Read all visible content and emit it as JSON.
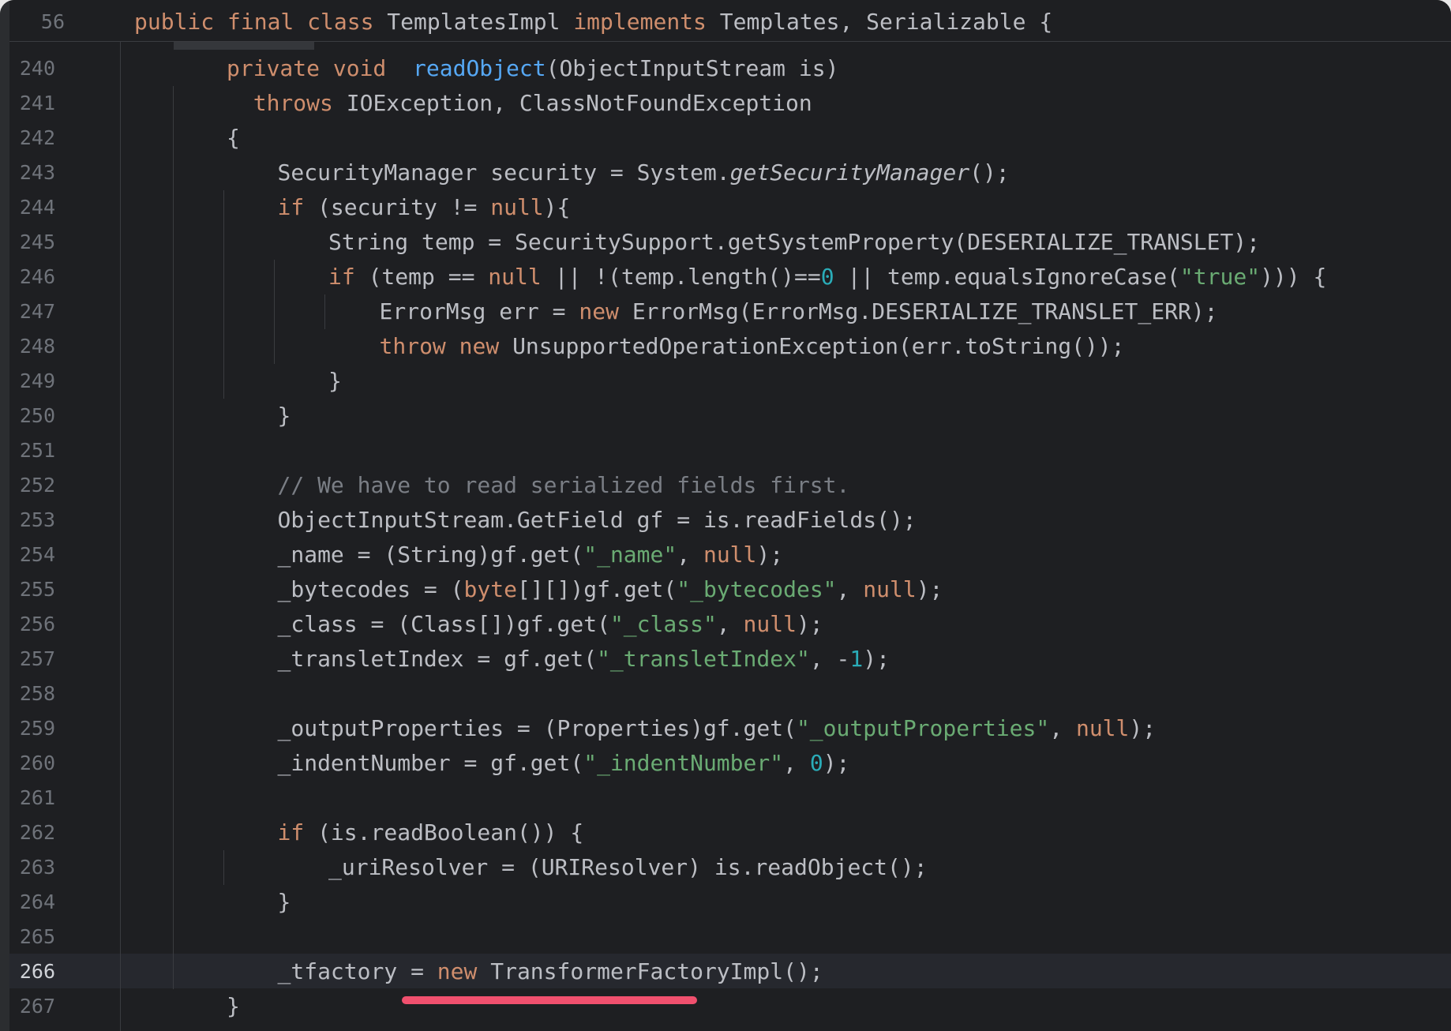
{
  "sticky_header": {
    "line_number": "56",
    "tokens": [
      {
        "t": "public final class ",
        "c": "kw"
      },
      {
        "t": "TemplatesImpl ",
        "c": ""
      },
      {
        "t": "implements ",
        "c": "kw"
      },
      {
        "t": "Templates, Serializable {",
        "c": ""
      }
    ]
  },
  "current_line": "266",
  "colors": {
    "background": "#1e1f22",
    "keyword": "#cf8e6d",
    "method_declaration": "#56a8f5",
    "string": "#6aab73",
    "number": "#2aacb8",
    "comment": "#7a7e85",
    "text": "#bcbec4",
    "underline": "#f0506e"
  },
  "lines": [
    {
      "n": "240",
      "indent": 2,
      "tokens": [
        {
          "t": "private void  ",
          "c": "kw"
        },
        {
          "t": "readObject",
          "c": "fn"
        },
        {
          "t": "(ObjectInputStream is)",
          "c": ""
        }
      ]
    },
    {
      "n": "241",
      "indent": 2,
      "tokens": [
        {
          "t": "  ",
          "c": ""
        },
        {
          "t": "throws ",
          "c": "kw"
        },
        {
          "t": "IOException, ClassNotFoundException",
          "c": ""
        }
      ]
    },
    {
      "n": "242",
      "indent": 2,
      "tokens": [
        {
          "t": "{",
          "c": ""
        }
      ]
    },
    {
      "n": "243",
      "indent": 3,
      "tokens": [
        {
          "t": "SecurityManager security = System.",
          "c": ""
        },
        {
          "t": "getSecurityManager",
          "c": "it"
        },
        {
          "t": "();",
          "c": ""
        }
      ]
    },
    {
      "n": "244",
      "indent": 3,
      "tokens": [
        {
          "t": "if ",
          "c": "kw"
        },
        {
          "t": "(security != ",
          "c": ""
        },
        {
          "t": "null",
          "c": "kw"
        },
        {
          "t": "){",
          "c": ""
        }
      ]
    },
    {
      "n": "245",
      "indent": 4,
      "tokens": [
        {
          "t": "String temp = SecuritySupport.getSystemProperty(DESERIALIZE_TRANSLET);",
          "c": ""
        }
      ]
    },
    {
      "n": "246",
      "indent": 4,
      "tokens": [
        {
          "t": "if ",
          "c": "kw"
        },
        {
          "t": "(temp == ",
          "c": ""
        },
        {
          "t": "null",
          "c": "kw"
        },
        {
          "t": " || !(temp.length()==",
          "c": ""
        },
        {
          "t": "0",
          "c": "num"
        },
        {
          "t": " || temp.equalsIgnoreCase(",
          "c": ""
        },
        {
          "t": "\"true\"",
          "c": "str"
        },
        {
          "t": "))) {",
          "c": ""
        }
      ]
    },
    {
      "n": "247",
      "indent": 5,
      "tokens": [
        {
          "t": "ErrorMsg err = ",
          "c": ""
        },
        {
          "t": "new ",
          "c": "kw"
        },
        {
          "t": "ErrorMsg(ErrorMsg.DESERIALIZE_TRANSLET_ERR);",
          "c": ""
        }
      ]
    },
    {
      "n": "248",
      "indent": 5,
      "tokens": [
        {
          "t": "throw new ",
          "c": "kw"
        },
        {
          "t": "UnsupportedOperationException(err.toString());",
          "c": ""
        }
      ]
    },
    {
      "n": "249",
      "indent": 4,
      "tokens": [
        {
          "t": "}",
          "c": ""
        }
      ]
    },
    {
      "n": "250",
      "indent": 3,
      "tokens": [
        {
          "t": "}",
          "c": ""
        }
      ]
    },
    {
      "n": "251",
      "indent": 3,
      "tokens": []
    },
    {
      "n": "252",
      "indent": 3,
      "tokens": [
        {
          "t": "// We have to read serialized fields first.",
          "c": "cm"
        }
      ]
    },
    {
      "n": "253",
      "indent": 3,
      "tokens": [
        {
          "t": "ObjectInputStream.GetField gf = is.readFields();",
          "c": ""
        }
      ]
    },
    {
      "n": "254",
      "indent": 3,
      "tokens": [
        {
          "t": "_name = (String)gf.get(",
          "c": ""
        },
        {
          "t": "\"_name\"",
          "c": "str"
        },
        {
          "t": ", ",
          "c": ""
        },
        {
          "t": "null",
          "c": "kw"
        },
        {
          "t": ");",
          "c": ""
        }
      ]
    },
    {
      "n": "255",
      "indent": 3,
      "tokens": [
        {
          "t": "_bytecodes = (",
          "c": ""
        },
        {
          "t": "byte",
          "c": "kw"
        },
        {
          "t": "[][])gf.get(",
          "c": ""
        },
        {
          "t": "\"_bytecodes\"",
          "c": "str"
        },
        {
          "t": ", ",
          "c": ""
        },
        {
          "t": "null",
          "c": "kw"
        },
        {
          "t": ");",
          "c": ""
        }
      ]
    },
    {
      "n": "256",
      "indent": 3,
      "tokens": [
        {
          "t": "_class = (Class[])gf.get(",
          "c": ""
        },
        {
          "t": "\"_class\"",
          "c": "str"
        },
        {
          "t": ", ",
          "c": ""
        },
        {
          "t": "null",
          "c": "kw"
        },
        {
          "t": ");",
          "c": ""
        }
      ]
    },
    {
      "n": "257",
      "indent": 3,
      "tokens": [
        {
          "t": "_transletIndex = gf.get(",
          "c": ""
        },
        {
          "t": "\"_transletIndex\"",
          "c": "str"
        },
        {
          "t": ", -",
          "c": ""
        },
        {
          "t": "1",
          "c": "num"
        },
        {
          "t": ");",
          "c": ""
        }
      ]
    },
    {
      "n": "258",
      "indent": 3,
      "tokens": []
    },
    {
      "n": "259",
      "indent": 3,
      "tokens": [
        {
          "t": "_outputProperties = (Properties)gf.get(",
          "c": ""
        },
        {
          "t": "\"_outputProperties\"",
          "c": "str"
        },
        {
          "t": ", ",
          "c": ""
        },
        {
          "t": "null",
          "c": "kw"
        },
        {
          "t": ");",
          "c": ""
        }
      ]
    },
    {
      "n": "260",
      "indent": 3,
      "tokens": [
        {
          "t": "_indentNumber = gf.get(",
          "c": ""
        },
        {
          "t": "\"_indentNumber\"",
          "c": "str"
        },
        {
          "t": ", ",
          "c": ""
        },
        {
          "t": "0",
          "c": "num"
        },
        {
          "t": ");",
          "c": ""
        }
      ]
    },
    {
      "n": "261",
      "indent": 3,
      "tokens": []
    },
    {
      "n": "262",
      "indent": 3,
      "tokens": [
        {
          "t": "if ",
          "c": "kw"
        },
        {
          "t": "(is.readBoolean()) {",
          "c": ""
        }
      ]
    },
    {
      "n": "263",
      "indent": 4,
      "tokens": [
        {
          "t": "_uriResolver = (URIResolver) is.readObject();",
          "c": ""
        }
      ]
    },
    {
      "n": "264",
      "indent": 3,
      "tokens": [
        {
          "t": "}",
          "c": ""
        }
      ]
    },
    {
      "n": "265",
      "indent": 3,
      "tokens": []
    },
    {
      "n": "266",
      "indent": 3,
      "tokens": [
        {
          "t": "_tfactory = ",
          "c": ""
        },
        {
          "t": "new ",
          "c": "kw"
        },
        {
          "t": "TransformerFactoryImpl();",
          "c": ""
        }
      ]
    },
    {
      "n": "267",
      "indent": 2,
      "tokens": [
        {
          "t": "}",
          "c": ""
        }
      ]
    }
  ]
}
